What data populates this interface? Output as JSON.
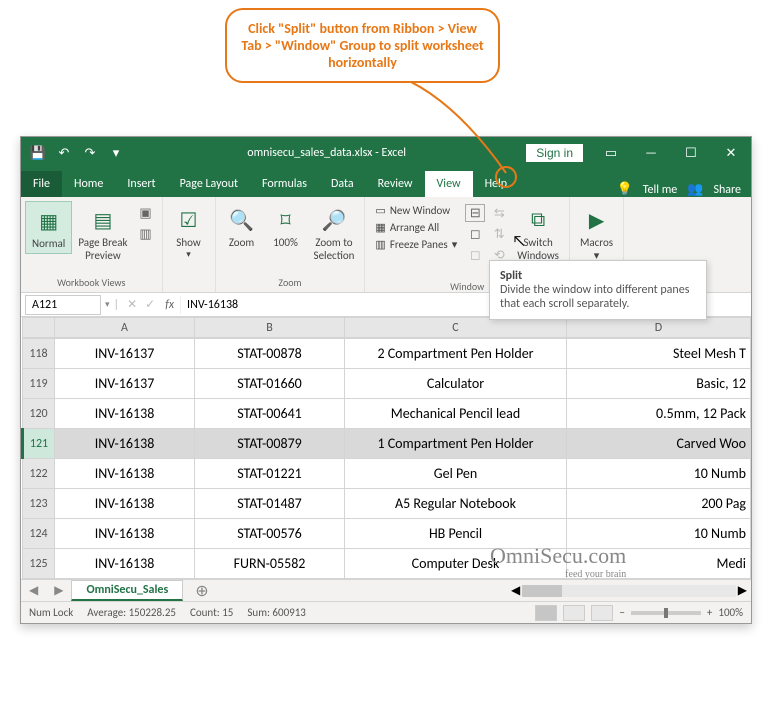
{
  "callout": "Click \"Split\" button from Ribbon > View Tab > \"Window\" Group to split worksheet horizontally",
  "titlebar": {
    "title": "omnisecu_sales_data.xlsx - Excel",
    "signin": "Sign in"
  },
  "tabs": {
    "file": "File",
    "items": [
      "Home",
      "Insert",
      "Page Layout",
      "Formulas",
      "Data",
      "Review",
      "View",
      "Help"
    ],
    "active": "View",
    "tellme": "Tell me",
    "share": "Share"
  },
  "ribbon": {
    "wbviews": {
      "label": "Workbook Views",
      "normal": "Normal",
      "pbreak": "Page Break\nPreview"
    },
    "show": {
      "label": "",
      "btn": "Show"
    },
    "zoom": {
      "label": "Zoom",
      "zoom": "Zoom",
      "pct": "100%",
      "sel": "Zoom to\nSelection"
    },
    "window": {
      "label": "Window",
      "new": "New Window",
      "arrange": "Arrange All",
      "freeze": "Freeze Panes",
      "switch": "Switch\nWindows"
    },
    "macros": {
      "label": "Macros",
      "btn": "Macros"
    }
  },
  "tooltip": {
    "title": "Split",
    "body": "Divide the window into different panes that each scroll separately."
  },
  "namebox": "A121",
  "formula": "INV-16138",
  "columns": [
    "A",
    "B",
    "C",
    "D"
  ],
  "rows": [
    {
      "num": "118",
      "a": "INV-16137",
      "b": "STAT-00878",
      "c": "2 Compartment Pen Holder",
      "d": "Steel Mesh T"
    },
    {
      "num": "119",
      "a": "INV-16137",
      "b": "STAT-01660",
      "c": "Calculator",
      "d": "Basic, 12"
    },
    {
      "num": "120",
      "a": "INV-16138",
      "b": "STAT-00641",
      "c": "Mechanical Pencil lead",
      "d": "0.5mm, 12 Pack"
    },
    {
      "num": "121",
      "a": "INV-16138",
      "b": "STAT-00879",
      "c": "1 Compartment Pen Holder",
      "d": "Carved Woo",
      "sel": true
    },
    {
      "num": "122",
      "a": "INV-16138",
      "b": "STAT-01221",
      "c": "Gel Pen",
      "d": "10 Numb"
    },
    {
      "num": "123",
      "a": "INV-16138",
      "b": "STAT-01487",
      "c": "A5 Regular Notebook",
      "d": "200 Pag"
    },
    {
      "num": "124",
      "a": "INV-16138",
      "b": "STAT-00576",
      "c": "HB Pencil",
      "d": "10 Numb"
    },
    {
      "num": "125",
      "a": "INV-16138",
      "b": "FURN-05582",
      "c": "Computer Desk",
      "d": "Medi"
    }
  ],
  "sheettab": "OmniSecu_Sales",
  "status": {
    "numlock": "Num Lock",
    "avg": "Average: 150228.25",
    "count": "Count: 15",
    "sum": "Sum: 600913",
    "zoom": "100%"
  },
  "watermark": {
    "main": "OmniSecu.com",
    "sub": "feed your brain"
  }
}
